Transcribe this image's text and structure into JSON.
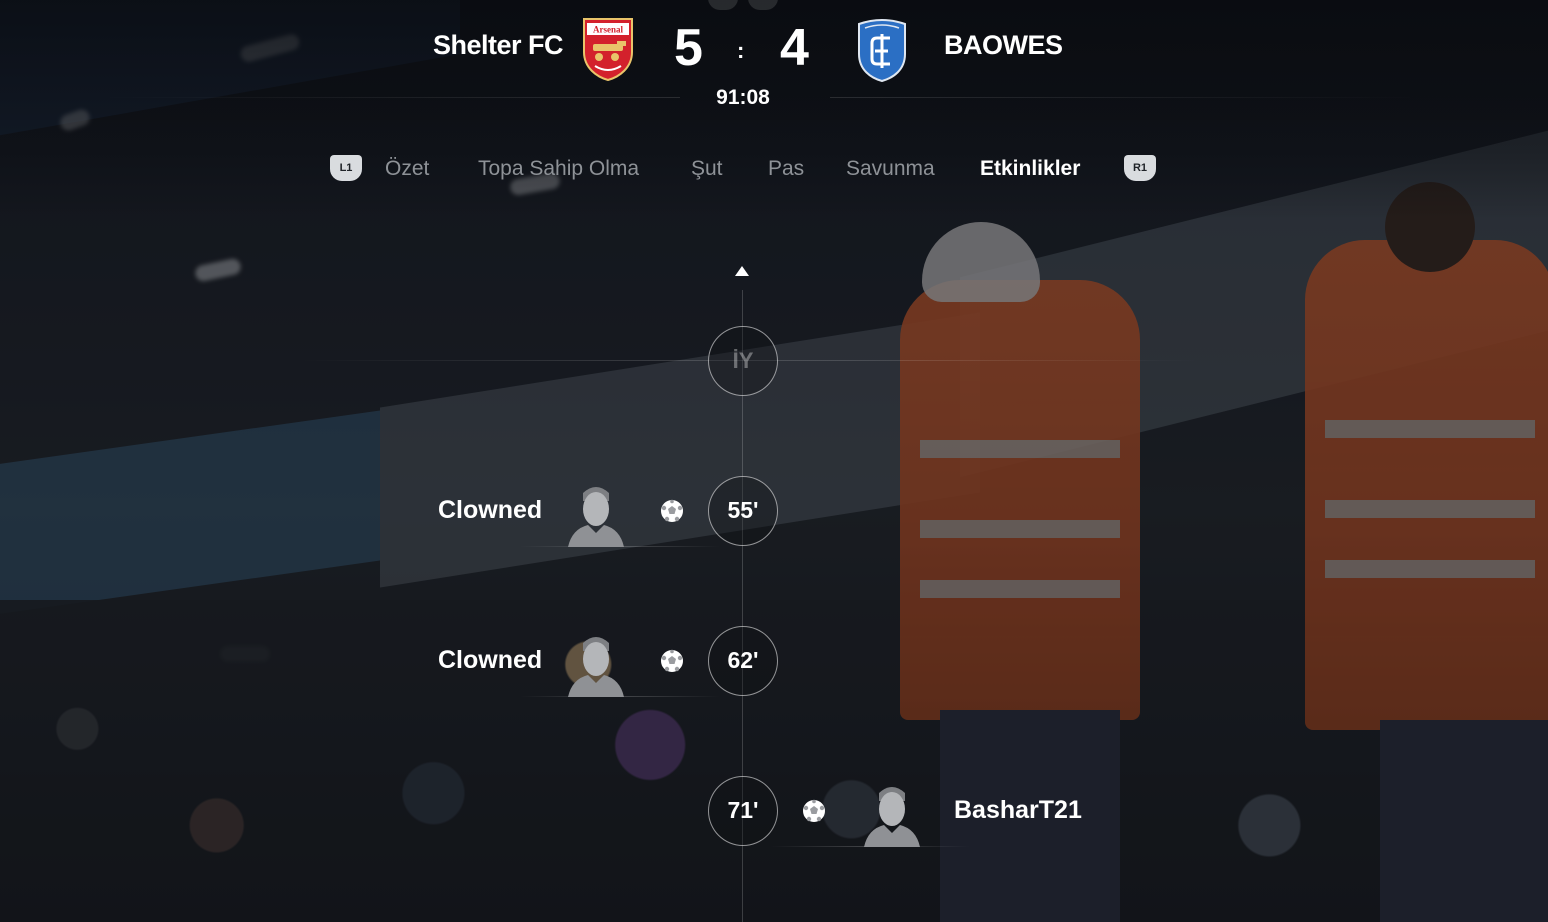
{
  "scoreboard": {
    "home_team": "Shelter FC",
    "away_team": "BAOWES",
    "home_score": "5",
    "separator": ":",
    "away_score": "4",
    "clock": "91:08",
    "home_crest_text": "Arsenal",
    "home_crest_icon": "arsenal-crest-icon",
    "away_crest_icon": "empoli-crest-icon"
  },
  "tabs": {
    "left_bumper": "L1",
    "right_bumper": "R1",
    "items": [
      {
        "label": "Özet",
        "active": false
      },
      {
        "label": "Topa Sahip Olma",
        "active": false
      },
      {
        "label": "Şut",
        "active": false
      },
      {
        "label": "Pas",
        "active": false
      },
      {
        "label": "Savunma",
        "active": false
      },
      {
        "label": "Etkinlikler",
        "active": true
      }
    ]
  },
  "timeline": {
    "half_marker": "İY",
    "events": [
      {
        "minute": "55'",
        "player": "Clowned",
        "type": "goal",
        "side": "home"
      },
      {
        "minute": "62'",
        "player": "Clowned",
        "type": "goal",
        "side": "home"
      },
      {
        "minute": "71'",
        "player": "BasharT21",
        "type": "goal",
        "side": "away"
      }
    ]
  },
  "colors": {
    "active_tab": "#ffffff",
    "inactive_tab": "#8e9297",
    "home_crest_red": "#d3212c",
    "away_crest_blue": "#2b6fc4",
    "steward_orange": "#d35f2f"
  }
}
